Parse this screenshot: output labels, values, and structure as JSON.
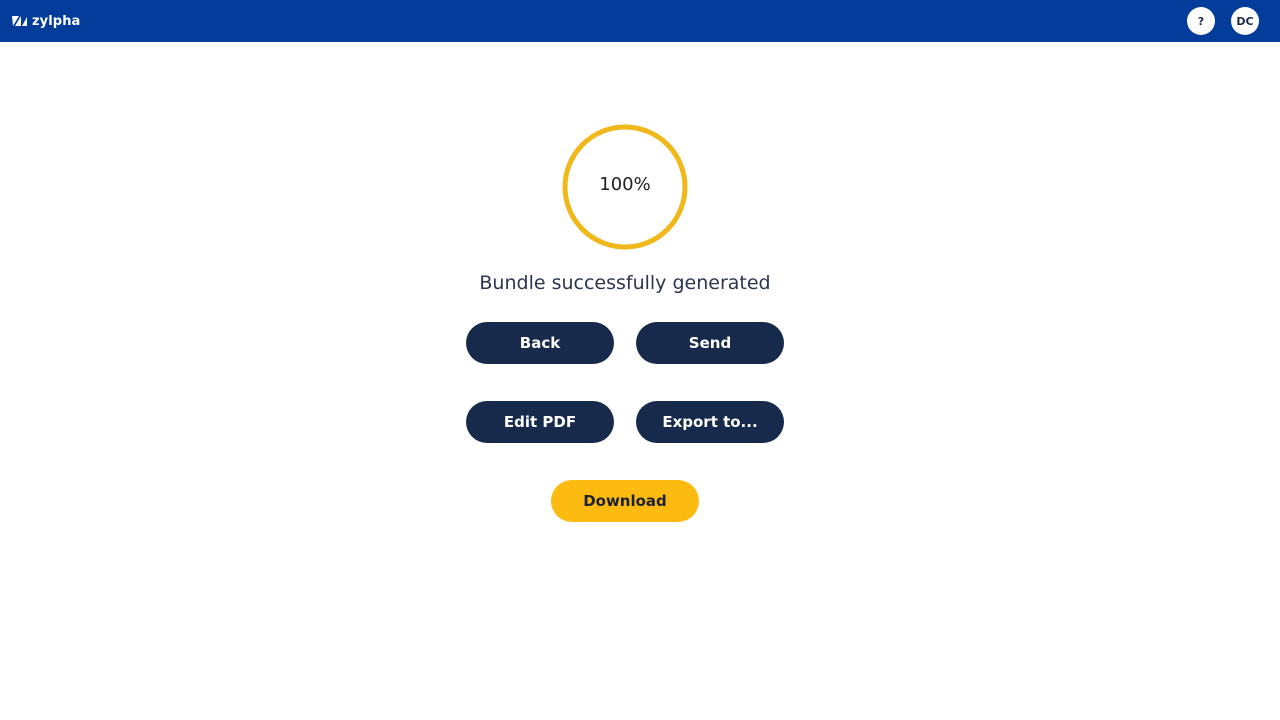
{
  "app": {
    "name": "zylpha",
    "colors": {
      "topbar": "#043c9b",
      "primary_button": "#172a4b",
      "accent_button": "#fdbb11",
      "progress_ring": "#f0b81b"
    }
  },
  "header": {
    "help_label": "?",
    "user_initials": "DC"
  },
  "progress": {
    "value": 100,
    "label": "100%"
  },
  "status": {
    "message": "Bundle successfully generated"
  },
  "actions": {
    "back": "Back",
    "send": "Send",
    "edit_pdf": "Edit PDF",
    "export": "Export to...",
    "download": "Download"
  },
  "icons": {
    "logo": "zylpha-logo-icon"
  }
}
